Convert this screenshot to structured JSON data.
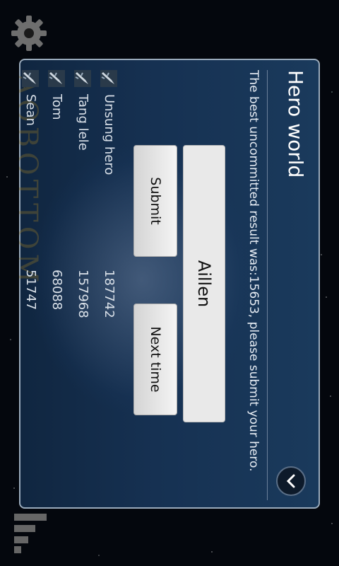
{
  "dialog": {
    "title": "Hero world",
    "message": "The best uncommitted result was:15653, please submit your hero.",
    "name_value": "Aillen",
    "submit_label": "Submit",
    "next_label": "Next time"
  },
  "leaderboard": [
    {
      "name": "Unsung hero",
      "score": "187742"
    },
    {
      "name": "Tang lele",
      "score": "157968"
    },
    {
      "name": "Tom",
      "score": "68088"
    },
    {
      "name": "Sean",
      "score": "51747"
    }
  ],
  "watermark": "AOBOTTOM",
  "colors": {
    "accent": "#1a3a5c",
    "button": "#e0e0e0"
  },
  "icons": [
    "settings-gear-icon",
    "signal-bars-icon",
    "chevron-down-icon",
    "ship-icon"
  ]
}
